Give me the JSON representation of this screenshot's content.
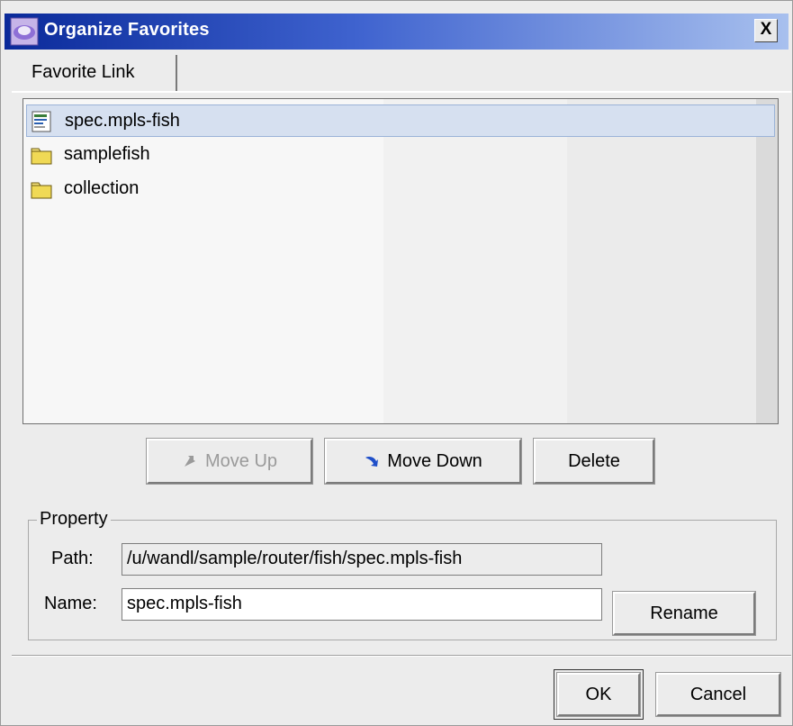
{
  "window": {
    "title": "Organize Favorites",
    "close_label": "X"
  },
  "tabs": [
    {
      "label": "Favorite Link"
    }
  ],
  "list": {
    "items": [
      {
        "label": "spec.mpls-fish",
        "icon": "favorite-link-icon",
        "selected": true
      },
      {
        "label": "samplefish",
        "icon": "folder-icon",
        "selected": false
      },
      {
        "label": "collection",
        "icon": "folder-icon",
        "selected": false
      }
    ]
  },
  "list_actions": {
    "move_up_label": "Move Up",
    "move_down_label": "Move Down",
    "delete_label": "Delete"
  },
  "property": {
    "title": "Property",
    "path_label": "Path:",
    "path_value": "/u/wandl/sample/router/fish/spec.mpls-fish",
    "name_label": "Name:",
    "name_value": "spec.mpls-fish",
    "rename_label": "Rename"
  },
  "footer": {
    "ok_label": "OK",
    "cancel_label": "Cancel"
  }
}
